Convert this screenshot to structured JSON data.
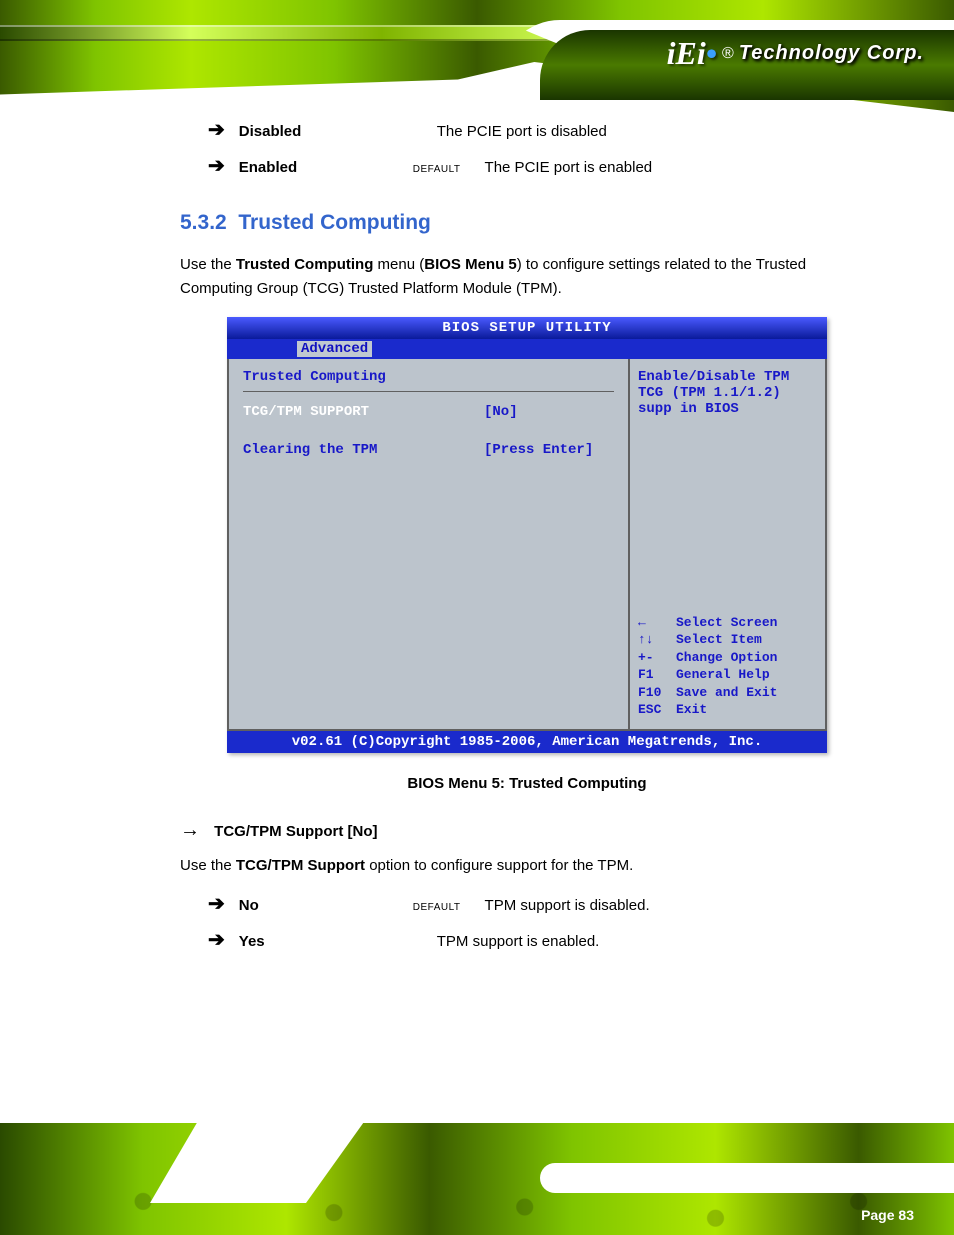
{
  "brand": {
    "logo": "iEi",
    "registered": "®",
    "tagline": "Technology Corp."
  },
  "options1": [
    {
      "label": "Disabled",
      "default": "",
      "desc": "The PCIE port is disabled"
    },
    {
      "label": "Enabled",
      "default": "DEFAULT",
      "desc": "The PCIE port is enabled"
    }
  ],
  "section": {
    "number": "5.3.2",
    "title": "Trusted Computing"
  },
  "intro": "Use the Trusted Computing menu (BIOS Menu 5) to configure settings related to the Trusted Computing Group (TCG) Trusted Platform Module (TPM).",
  "intro_bold": "Trusted Computing",
  "intro_ref": "BIOS Menu 5",
  "bios": {
    "title": "BIOS SETUP UTILITY",
    "tab": "Advanced",
    "heading": "Trusted Computing",
    "rows": [
      {
        "label": "TCG/TPM SUPPORT",
        "value": "[No]",
        "selected": true
      },
      {
        "label": "Clearing the TPM",
        "value": "[Press Enter]",
        "selected": false
      }
    ],
    "help": "Enable/Disable TPM TCG (TPM 1.1/1.2) supp in BIOS",
    "keys": [
      {
        "k": "←",
        "t": "Select Screen"
      },
      {
        "k": "↑↓",
        "t": "Select Item"
      },
      {
        "k": "+-",
        "t": "Change Option"
      },
      {
        "k": "F1",
        "t": "General Help"
      },
      {
        "k": "F10",
        "t": "Save and Exit"
      },
      {
        "k": "ESC",
        "t": "Exit"
      }
    ],
    "footer": "v02.61 (C)Copyright 1985-2006, American Megatrends, Inc."
  },
  "figure_caption": "BIOS Menu 5: Trusted Computing",
  "subsection": {
    "arrow": "→",
    "title": "TCG/TPM Support [No]"
  },
  "tpm_para": "Use the TCG/TPM Support option to configure support for the TPM.",
  "tpm_bold": "TCG/TPM Support",
  "options2": [
    {
      "label": "No",
      "default": "DEFAULT",
      "desc": "TPM support is disabled."
    },
    {
      "label": "Yes",
      "default": "",
      "desc": "TPM support is enabled."
    }
  ],
  "page": "Page 83"
}
